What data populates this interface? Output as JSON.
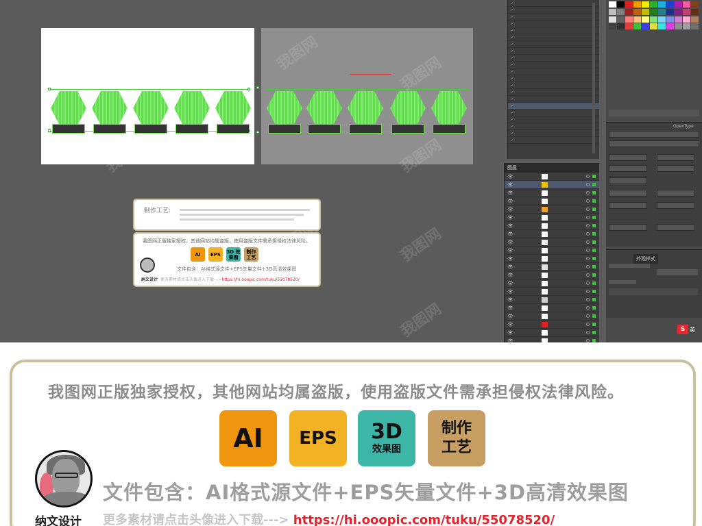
{
  "artboards": {
    "left_signs": 5,
    "right_signs": 5,
    "right_annotation": "",
    "right_annotation2": ""
  },
  "card_craft": {
    "label": "制作工艺:"
  },
  "card_small": {
    "notice": "我图网正版独家授权，其他网站均属盗版，使用盗版文件需承担侵权法律风险。",
    "badges": [
      "AI",
      "EPS",
      "3D 效果图",
      "制作 工艺"
    ],
    "files": "文件包含：AI格式源文件+EPS矢量文件+3D高清效果图",
    "author": "纳文设计",
    "more": "更多素材请点击头像进入下载--->",
    "link": "https://hi.ooopic.com/tuku/55078520/"
  },
  "layers_top": {
    "rows": [
      "",
      "",
      "",
      "",
      "",
      "",
      "",
      "",
      "",
      "",
      "",
      "",
      "",
      "",
      "",
      "",
      "",
      "",
      "",
      "",
      ""
    ]
  },
  "layers_panel": {
    "tab": "图层",
    "row_count": 21
  },
  "right_panel": {
    "char_tab": "OpenType",
    "app_tab": "外观样式"
  },
  "ime": {
    "icon": "S",
    "text": "英"
  },
  "watermark": "我图网",
  "bottom": {
    "notice": "我图网正版独家授权，其他网站均属盗版，使用盗版文件需承担侵权法律风险。",
    "badge_ai": "AI",
    "badge_eps": "EPS",
    "badge_3d_big": "3D",
    "badge_3d_small": "效果图",
    "badge_craft_1": "制作",
    "badge_craft_2": "工艺",
    "files": "文件包含：AI格式源文件+EPS矢量文件+3D高清效果图",
    "author": "纳文设计",
    "more": "更多素材请点击头像进入下载--->",
    "link": "https://hi.ooopic.com/tuku/55078520/"
  },
  "colors": {
    "workspace": "#5b5b5b",
    "sign_green": "#5fe04a",
    "card_border": "#c9b896",
    "big_card_border": "#cdbf9c",
    "link_red": "#e3232b",
    "badge_ai": "#f0950e",
    "badge_eps": "#f3b223",
    "badge_3d": "#3db6a8",
    "badge_craft": "#c79f63"
  }
}
